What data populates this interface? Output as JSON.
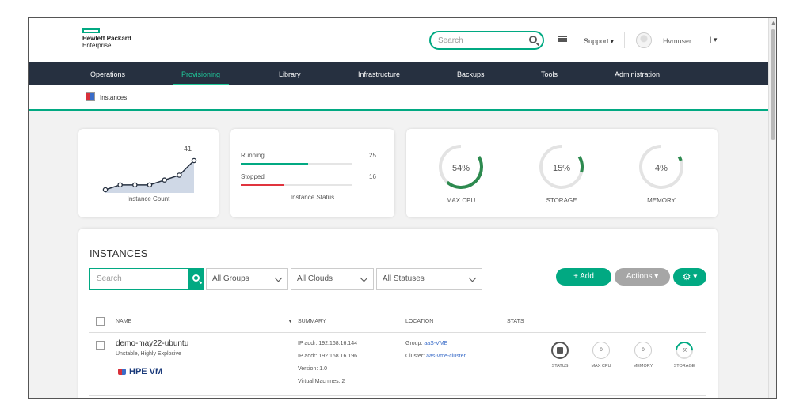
{
  "header": {
    "logo_line1": "Hewlett Packard",
    "logo_line2": "Enterprise",
    "search_placeholder": "Search",
    "support_label": "Support",
    "username": "Hvmuser"
  },
  "nav": {
    "items": [
      "Operations",
      "Provisioning",
      "Library",
      "Infrastructure",
      "Backups",
      "Tools",
      "Administration"
    ],
    "active": "Provisioning"
  },
  "breadcrumb": {
    "label": "Instances"
  },
  "summary": {
    "instance_count": {
      "value": "41",
      "label": "Instance Count",
      "series": [
        1,
        2,
        2,
        2,
        3,
        4,
        7
      ]
    },
    "instance_status": {
      "label": "Instance Status",
      "rows": [
        {
          "label": "Running",
          "value": "25",
          "fraction": 0.61,
          "color": "#01a982"
        },
        {
          "label": "Stopped",
          "value": "16",
          "fraction": 0.39,
          "color": "#e0343e"
        }
      ]
    },
    "gauges": [
      {
        "pct": "54%",
        "value": 54,
        "label": "MAX CPU"
      },
      {
        "pct": "15%",
        "value": 15,
        "label": "STORAGE"
      },
      {
        "pct": "4%",
        "value": 4,
        "label": "MEMORY"
      }
    ]
  },
  "instances": {
    "title": "INSTANCES",
    "search_placeholder": "Search",
    "filters": [
      "All Groups",
      "All Clouds",
      "All Statuses"
    ],
    "add_label": "+ Add",
    "actions_label": "Actions",
    "columns": [
      "NAME",
      "SUMMARY",
      "LOCATION",
      "STATS"
    ],
    "rows": [
      {
        "name": "demo-may22-ubuntu",
        "description": "Unstable, Highly Explosive",
        "type": "HPE VM",
        "summary": [
          "IP addr: 192.168.16.144",
          "IP addr: 192.168.16.196",
          "Version: 1.0",
          "Virtual Machines: 2"
        ],
        "group_label": "Group:",
        "group_value": "aaS-VME",
        "cluster_label": "Cluster:",
        "cluster_value": "aas-vme-cluster",
        "stats": [
          {
            "label": "STATUS",
            "value": ""
          },
          {
            "label": "MAX CPU",
            "value": "0"
          },
          {
            "label": "MEMORY",
            "value": "0"
          },
          {
            "label": "STORAGE",
            "value": "50"
          }
        ]
      }
    ]
  },
  "colors": {
    "accent": "#01a982",
    "nav_bg": "#263040",
    "stopped": "#e0343e",
    "actions_bg": "#a6a6a6"
  }
}
